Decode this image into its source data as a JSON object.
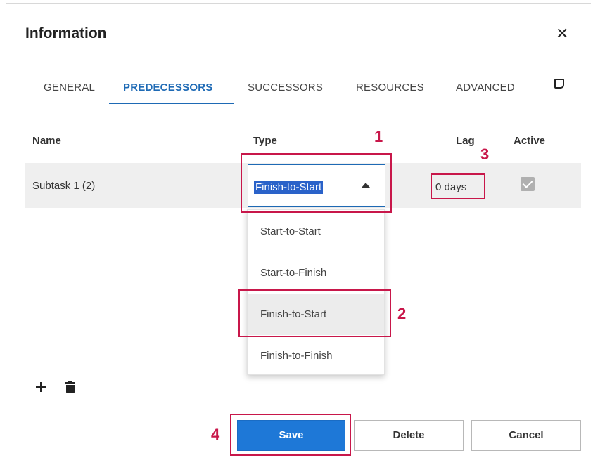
{
  "dialog": {
    "title": "Information",
    "close_icon": "close-icon"
  },
  "tabs": [
    {
      "label": "GENERAL",
      "active": false
    },
    {
      "label": "PREDECESSORS",
      "active": true
    },
    {
      "label": "SUCCESSORS",
      "active": false
    },
    {
      "label": "RESOURCES",
      "active": false
    },
    {
      "label": "ADVANCED",
      "active": false
    }
  ],
  "notes_icon": "notes-icon",
  "table": {
    "columns": [
      "Name",
      "Type",
      "Lag",
      "Active"
    ],
    "rows": [
      {
        "name": "Subtask 1 (2)",
        "type": "Finish-to-Start",
        "lag": "0 days",
        "active": true
      }
    ]
  },
  "type_dropdown": {
    "options": [
      "Start-to-Start",
      "Start-to-Finish",
      "Finish-to-Start",
      "Finish-to-Finish"
    ],
    "selected": "Finish-to-Start"
  },
  "callouts": [
    "1",
    "2",
    "3",
    "4"
  ],
  "toolbar": {
    "add_icon": "plus-icon",
    "delete_icon": "trash-icon"
  },
  "buttons": {
    "save": "Save",
    "delete": "Delete",
    "cancel": "Cancel"
  },
  "colors": {
    "accent": "#1e6ab5",
    "primary_button": "#1e78d7",
    "callout": "#c8174a",
    "selection_highlight": "#2a62c9"
  }
}
